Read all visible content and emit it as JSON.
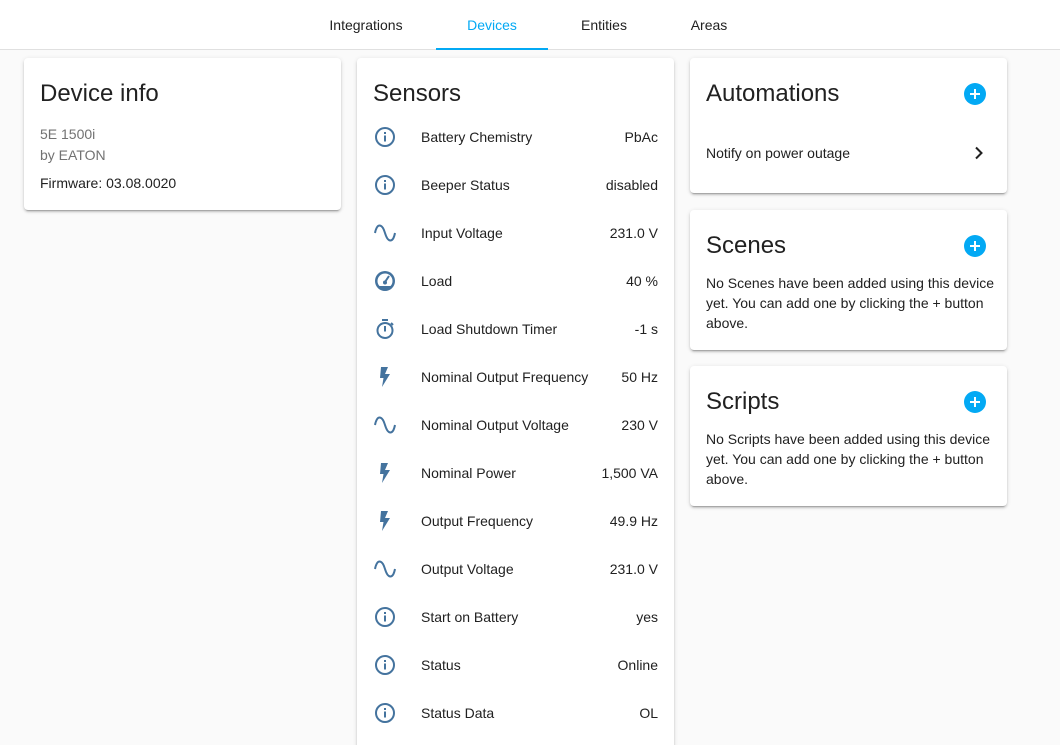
{
  "tabs": [
    {
      "label": "Integrations",
      "active": false
    },
    {
      "label": "Devices",
      "active": true
    },
    {
      "label": "Entities",
      "active": false
    },
    {
      "label": "Areas",
      "active": false
    }
  ],
  "device_info": {
    "title": "Device info",
    "model": "5E 1500i",
    "manufacturer": "by EATON",
    "firmware": "Firmware: 03.08.0020"
  },
  "sensors": {
    "title": "Sensors",
    "items": [
      {
        "icon": "info-icon",
        "name": "Battery Chemistry",
        "value": "PbAc"
      },
      {
        "icon": "info-icon",
        "name": "Beeper Status",
        "value": "disabled"
      },
      {
        "icon": "sine-wave-icon",
        "name": "Input Voltage",
        "value": "231.0 V"
      },
      {
        "icon": "gauge-icon",
        "name": "Load",
        "value": "40 %"
      },
      {
        "icon": "timer-icon",
        "name": "Load Shutdown Timer",
        "value": "-1 s"
      },
      {
        "icon": "flash-icon",
        "name": "Nominal Output Frequency",
        "value": "50 Hz"
      },
      {
        "icon": "sine-wave-icon",
        "name": "Nominal Output Voltage",
        "value": "230 V"
      },
      {
        "icon": "flash-icon",
        "name": "Nominal Power",
        "value": "1,500 VA"
      },
      {
        "icon": "flash-icon",
        "name": "Output Frequency",
        "value": "49.9 Hz"
      },
      {
        "icon": "sine-wave-icon",
        "name": "Output Voltage",
        "value": "231.0 V"
      },
      {
        "icon": "info-icon",
        "name": "Start on Battery",
        "value": "yes"
      },
      {
        "icon": "info-icon",
        "name": "Status",
        "value": "Online"
      },
      {
        "icon": "info-icon",
        "name": "Status Data",
        "value": "OL"
      }
    ]
  },
  "automations": {
    "title": "Automations",
    "items": [
      {
        "label": "Notify on power outage"
      }
    ]
  },
  "scenes": {
    "title": "Scenes",
    "empty_text": "No Scenes have been added using this device yet. You can add one by clicking the + button above."
  },
  "scripts": {
    "title": "Scripts",
    "empty_text": "No Scripts have been added using this device yet. You can add one by clicking the + button above."
  },
  "colors": {
    "accent": "#03a9f4",
    "icon": "#44739e"
  }
}
